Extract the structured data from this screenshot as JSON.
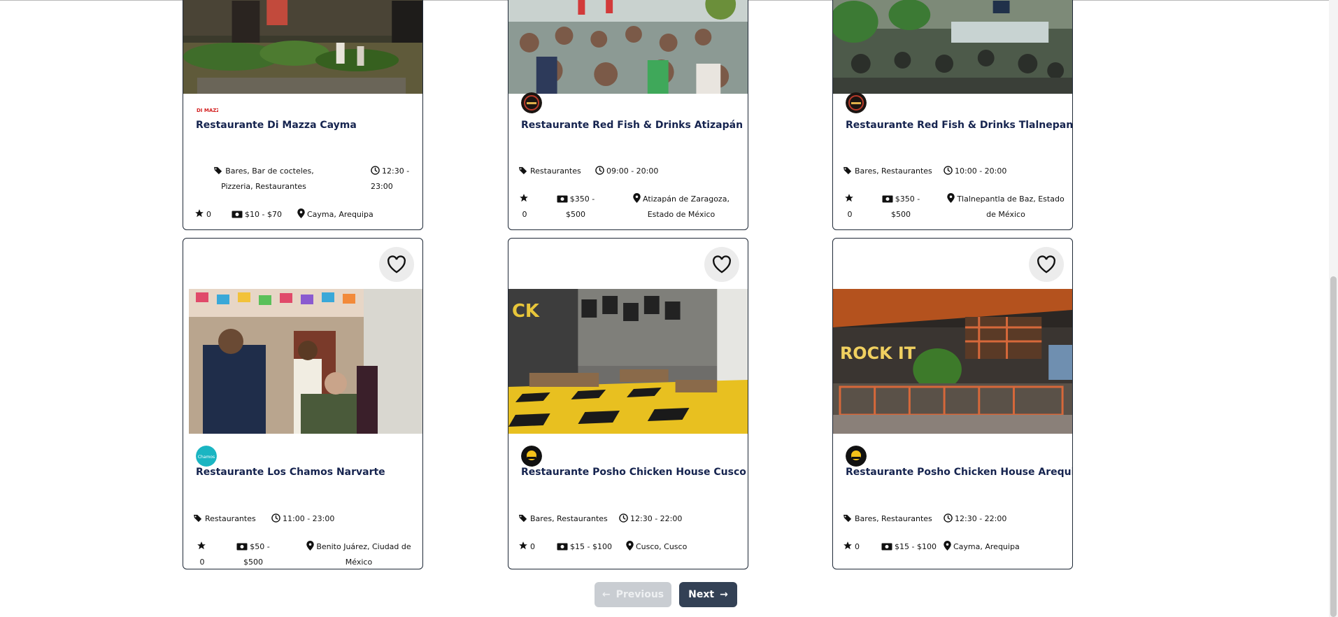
{
  "cards": [
    {
      "name": "Restaurante Di Mazza Cayma",
      "logo_text": "DI MAZZA",
      "categories": "Bares, Bar de cocteles, Pizzeria, Restaurantes",
      "hours": "12:30 - 23:00",
      "rating": "0",
      "price": "$10 - $70",
      "location": "Cayma, Arequipa"
    },
    {
      "name": "Restaurante Red Fish & Drinks Atizapán",
      "categories": "Restaurantes",
      "hours": "09:00 - 20:00",
      "rating": "0",
      "price": "$350 - $500",
      "location": "Atizapán de Zaragoza, Estado de México"
    },
    {
      "name": "Restaurante Red Fish & Drinks Tlalnepantla",
      "categories": "Bares, Restaurantes",
      "hours": "10:00 - 20:00",
      "rating": "0",
      "price": "$350 - $500",
      "location": "Tlalnepantla de Baz, Estado de México"
    },
    {
      "name": "Restaurante Los Chamos Narvarte",
      "logo_text": "Chamos",
      "categories": "Restaurantes",
      "hours": "11:00 - 23:00",
      "rating": "0",
      "price": "$50 - $500",
      "location": "Benito Juárez, Ciudad de México"
    },
    {
      "name": "Restaurante Posho Chicken House Cusco",
      "categories": "Bares, Restaurantes",
      "hours": "12:30 - 22:00",
      "rating": "0",
      "price": "$15 - $100",
      "location": "Cusco, Cusco",
      "photo_sign": "CK"
    },
    {
      "name": "Restaurante Posho Chicken House Arequipa",
      "categories": "Bares, Restaurantes",
      "hours": "12:30 - 22:00",
      "rating": "0",
      "price": "$15 - $100",
      "location": "Cayma, Arequipa",
      "photo_sign": "ROCK IT"
    }
  ],
  "pagination": {
    "previous_label": "Previous",
    "next_label": "Next"
  },
  "colors": {
    "title": "#16244f",
    "card_border": "#1f2937",
    "next_button": "#334155",
    "previous_button_disabled": "#c9cdd2",
    "favorite_bg": "#ececec"
  }
}
